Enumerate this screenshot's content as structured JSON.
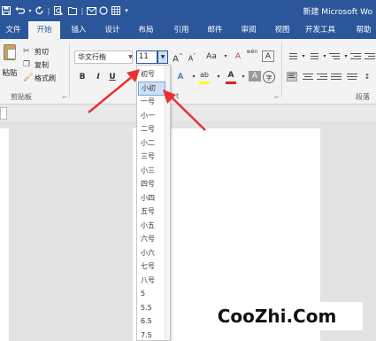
{
  "titlebar": {
    "window_title": "新建 Microsoft Wo",
    "qat_icons": [
      "save-icon",
      "undo-icon",
      "redo-icon",
      "print-preview-icon",
      "open-icon",
      "email-icon",
      "circle-icon",
      "table-icon",
      "more-icon"
    ],
    "qat_sep": "|"
  },
  "tabs": {
    "file": "文件",
    "home": "开始",
    "insert": "插入",
    "design": "设计",
    "layout": "布局",
    "references": "引用",
    "mailings": "邮件",
    "review": "审阅",
    "view": "视图",
    "developer": "开发工具",
    "help": "帮助"
  },
  "clipboard": {
    "paste_label": "粘贴",
    "cut_label": "剪切",
    "copy_label": "复制",
    "format_painter_label": "格式刷",
    "group_label": "剪贴板",
    "launcher": "⌐"
  },
  "font": {
    "font_name": "华文行楷",
    "font_size": "11",
    "grow_label": "A",
    "shrink_label": "A",
    "case_label": "Aa",
    "clear_label": "A",
    "phonetic_label": "wén",
    "border_label": "A",
    "bold_label": "B",
    "italic_label": "I",
    "underline_label": "U",
    "text_effect_label": "A",
    "highlight_label": "ab",
    "font_color_label": "A",
    "shading_label": "A",
    "enclose_label": "字",
    "group_label_fragment": "t",
    "highlight_color": "#ffff00",
    "font_color": "#e02020"
  },
  "paragraph": {
    "group_label": "段落"
  },
  "font_size_dropdown": {
    "items": [
      "初号",
      "小初",
      "一号",
      "小一",
      "二号",
      "小二",
      "三号",
      "小三",
      "四号",
      "小四",
      "五号",
      "小五",
      "六号",
      "小六",
      "七号",
      "八号",
      "5",
      "5.5",
      "6.5",
      "7.5"
    ],
    "selected_index": 1
  },
  "annotation": {
    "arrow_color": "#e8322d"
  },
  "watermark": {
    "text": "CooZhi.Com"
  }
}
